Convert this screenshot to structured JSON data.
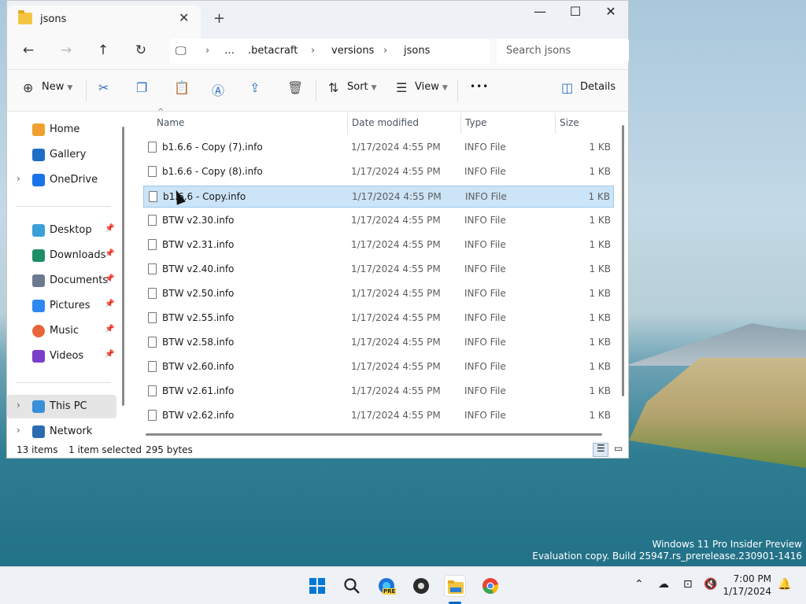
{
  "window": {
    "tab_title": "jsons",
    "new_tab_icon": "+",
    "controls": {
      "minimize": "—",
      "maximize": "☐",
      "close": "✕"
    }
  },
  "nav": {
    "path": [
      "…",
      ".betacraft",
      "versions",
      "jsons"
    ],
    "search_placeholder": "Search jsons"
  },
  "toolbar": {
    "new_label": "New",
    "sort_label": "Sort",
    "view_label": "View",
    "more_label": "•••",
    "details_label": "Details"
  },
  "sidebar": {
    "items": [
      {
        "label": "Home",
        "color": "#f0a030"
      },
      {
        "label": "Gallery",
        "color": "#1f6fc5"
      },
      {
        "label": "OneDrive",
        "color": "#1a73e8"
      },
      {
        "label": "Desktop",
        "color": "#3ba0d8"
      },
      {
        "label": "Downloads",
        "color": "#1e8e6a"
      },
      {
        "label": "Documents",
        "color": "#6b7a8f"
      },
      {
        "label": "Pictures",
        "color": "#2d89ef"
      },
      {
        "label": "Music",
        "color": "#e8643a"
      },
      {
        "label": "Videos",
        "color": "#7a3fc9"
      },
      {
        "label": "This PC",
        "color": "#3a8fd8"
      },
      {
        "label": "Network",
        "color": "#2b6cb0"
      }
    ]
  },
  "columns": {
    "name": "Name",
    "date": "Date modified",
    "type": "Type",
    "size": "Size"
  },
  "files": [
    {
      "name": "b1.6.6 - Copy (7).info",
      "date": "1/17/2024 4:55 PM",
      "type": "INFO File",
      "size": "1 KB"
    },
    {
      "name": "b1.6.6 - Copy (8).info",
      "date": "1/17/2024 4:55 PM",
      "type": "INFO File",
      "size": "1 KB"
    },
    {
      "name": "b1.6.6 - Copy.info",
      "date": "1/17/2024 4:55 PM",
      "type": "INFO File",
      "size": "1 KB"
    },
    {
      "name": "BTW v2.30.info",
      "date": "1/17/2024 4:55 PM",
      "type": "INFO File",
      "size": "1 KB"
    },
    {
      "name": "BTW v2.31.info",
      "date": "1/17/2024 4:55 PM",
      "type": "INFO File",
      "size": "1 KB"
    },
    {
      "name": "BTW v2.40.info",
      "date": "1/17/2024 4:55 PM",
      "type": "INFO File",
      "size": "1 KB"
    },
    {
      "name": "BTW v2.50.info",
      "date": "1/17/2024 4:55 PM",
      "type": "INFO File",
      "size": "1 KB"
    },
    {
      "name": "BTW v2.55.info",
      "date": "1/17/2024 4:55 PM",
      "type": "INFO File",
      "size": "1 KB"
    },
    {
      "name": "BTW v2.58.info",
      "date": "1/17/2024 4:55 PM",
      "type": "INFO File",
      "size": "1 KB"
    },
    {
      "name": "BTW v2.60.info",
      "date": "1/17/2024 4:55 PM",
      "type": "INFO File",
      "size": "1 KB"
    },
    {
      "name": "BTW v2.61.info",
      "date": "1/17/2024 4:55 PM",
      "type": "INFO File",
      "size": "1 KB"
    },
    {
      "name": "BTW v2.62.info",
      "date": "1/17/2024 4:55 PM",
      "type": "INFO File",
      "size": "1 KB"
    }
  ],
  "status": {
    "item_count": "13 items",
    "selection": "1 item selected",
    "size": "295 bytes"
  },
  "watermark": {
    "line1": "Windows 11 Pro Insider Preview",
    "line2": "Evaluation copy. Build 25947.rs_prerelease.230901-1416"
  },
  "taskbar": {
    "time": "7:00 PM",
    "date": "1/17/2024",
    "pre_badge": "PRE"
  }
}
